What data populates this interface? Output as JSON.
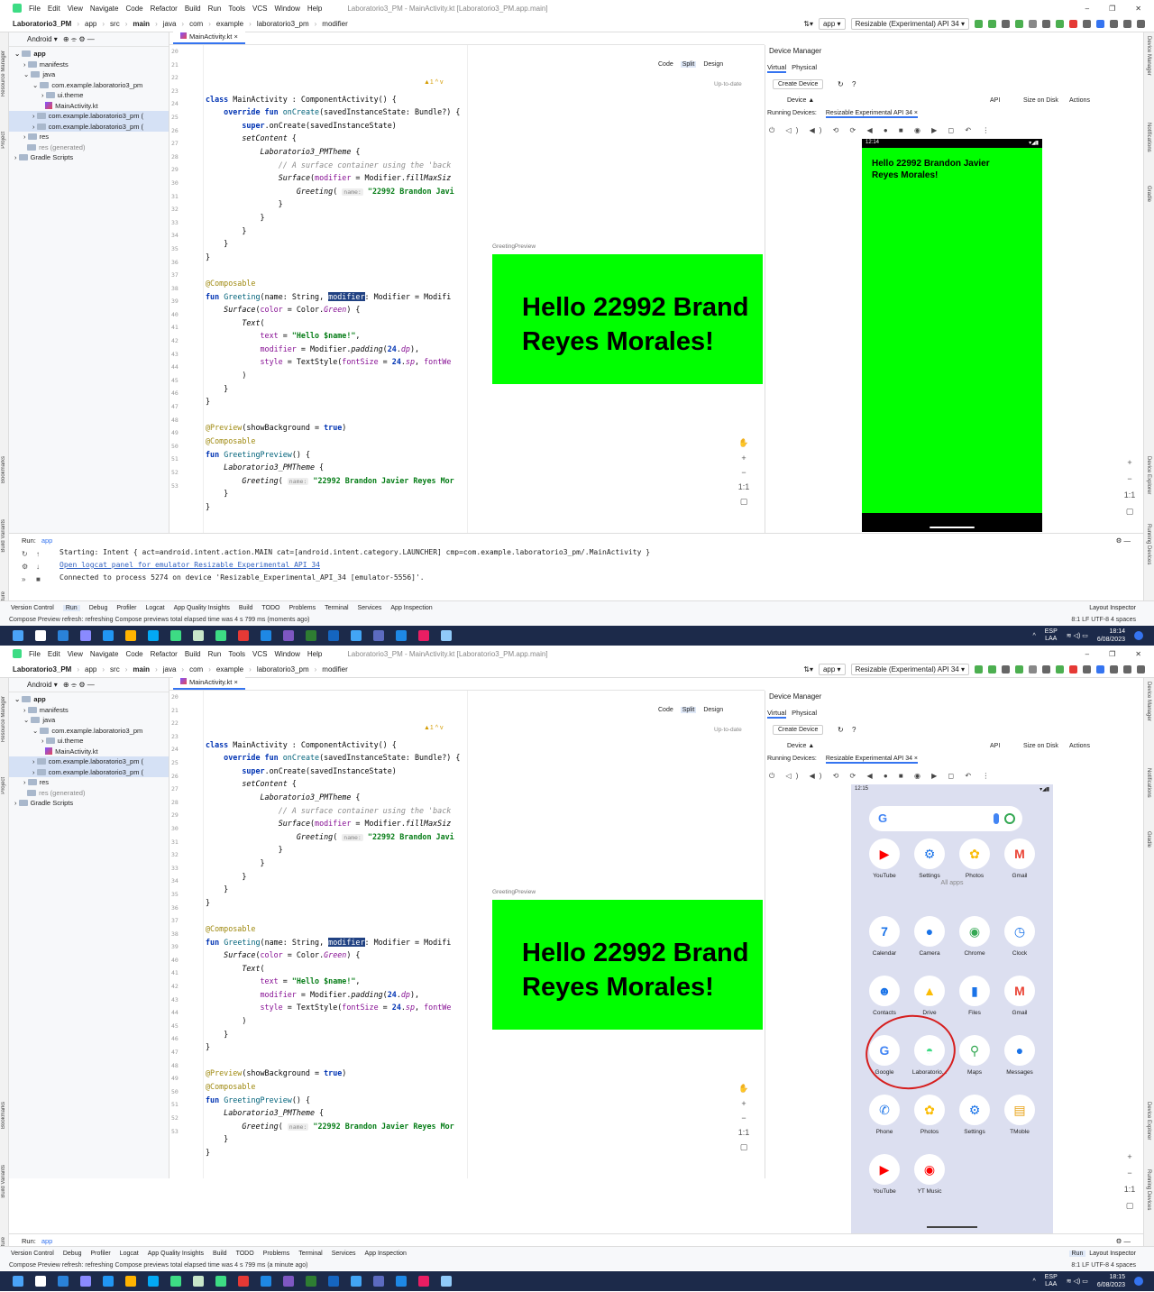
{
  "ide": {
    "menu": [
      "File",
      "Edit",
      "View",
      "Navigate",
      "Code",
      "Refactor",
      "Build",
      "Run",
      "Tools",
      "VCS",
      "Window",
      "Help"
    ],
    "window_title": "Laboratorio3_PM - MainActivity.kt [Laboratorio3_PM.app.main]",
    "breadcrumb": [
      "Laboratorio3_PM",
      "app",
      "src",
      "main",
      "java",
      "com",
      "example",
      "laboratorio3_pm",
      "modifier"
    ],
    "run_config": "app",
    "device_selector": "Resizable (Experimental) API 34",
    "project_view": "Android",
    "tree": [
      {
        "label": "app",
        "depth": 0
      },
      {
        "label": "manifests",
        "depth": 1
      },
      {
        "label": "java",
        "depth": 1
      },
      {
        "label": "com.example.laboratorio3_pm",
        "depth": 2
      },
      {
        "label": "ui.theme",
        "depth": 3
      },
      {
        "label": "MainActivity.kt",
        "depth": 3
      },
      {
        "label": "com.example.laboratorio3_pm (",
        "depth": 2
      },
      {
        "label": "com.example.laboratorio3_pm (",
        "depth": 2
      },
      {
        "label": "res",
        "depth": 1
      },
      {
        "label": "res (generated)",
        "depth": 1
      },
      {
        "label": "Gradle Scripts",
        "depth": 0
      }
    ],
    "editor_tab": "MainActivity.kt",
    "inspection": "▲1 ^ v",
    "view_modes": [
      "Code",
      "Split",
      "Design"
    ],
    "up_to_date": "Up-to-date",
    "preview_label": "GreetingPreview",
    "preview_text_line1": "Hello 22992 Brand",
    "preview_text_line2": "Reyes Morales!",
    "line_numbers": [
      "20",
      "21",
      "22",
      "23",
      "24",
      "25",
      "26",
      "27",
      "28",
      "29",
      "30",
      "31",
      "32",
      "33",
      "34",
      "35",
      "36",
      "37",
      "38",
      "39",
      "40",
      "41",
      "42",
      "43",
      "44",
      "45",
      "46",
      "47",
      "48",
      "49",
      "50",
      "51",
      "52",
      "53"
    ],
    "device_manager": {
      "title": "Device Manager",
      "tabs": [
        "Virtual",
        "Physical"
      ],
      "create": "Create Device",
      "help": "?",
      "col_device": "Device ▲",
      "col_api": "API",
      "col_size": "Size on Disk",
      "col_actions": "Actions",
      "running_label": "Running Devices:",
      "running_device": "Resizable Experimental API 34"
    },
    "run_panel": {
      "label": "Run:",
      "app": "app",
      "log1": "Starting: Intent { act=android.intent.action.MAIN cat=[android.intent.category.LAUNCHER] cmp=com.example.laboratorio3_pm/.MainActivity }",
      "log2": "Open logcat panel for emulator Resizable Experimental API 34",
      "log3": "Connected to process 5274 on device 'Resizable_Experimental_API_34 [emulator-5556]'."
    },
    "tool_windows": [
      "Version Control",
      "Run",
      "Debug",
      "Profiler",
      "Logcat",
      "App Quality Insights",
      "Build",
      "TODO",
      "Problems",
      "Terminal",
      "Services",
      "App Inspection"
    ],
    "tool_windows_2": [
      "Version Control",
      "Debug",
      "Profiler",
      "Logcat",
      "App Quality Insights",
      "Build",
      "TODO",
      "Problems",
      "Terminal",
      "Services",
      "App Inspection"
    ],
    "layout_inspector": "Layout Inspector",
    "status1": "Compose Preview refresh: refreshing Compose previews total elapsed time was 4 s 799 ms (moments ago)",
    "status2": "Compose Preview refresh: refreshing Compose previews total elapsed time was 4 s 799 ms (a minute ago)",
    "status_right": "8:1  LF  UTF-8  4 spaces",
    "left_strip": [
      "Resource Manager",
      "Project",
      "Bookmarks",
      "Build Variants",
      "Structure"
    ],
    "right_strip": [
      "Device Manager",
      "Notifications",
      "Gradle",
      "Device Explorer",
      "Running Devices"
    ]
  },
  "shot1": {
    "phone_time": "12:14",
    "app_message": "Hello 22992 Brandon Javier Reyes Morales!",
    "clock_time": "18:14",
    "clock_date": "6/08/2023"
  },
  "shot2": {
    "phone_time": "12:15",
    "all_apps": "All apps",
    "apps": [
      {
        "label": "YouTube",
        "color": "#ff0000",
        "glyph": "▶"
      },
      {
        "label": "Settings",
        "color": "#1a73e8",
        "glyph": "⚙"
      },
      {
        "label": "Photos",
        "color": "#fbbc04",
        "glyph": "✿"
      },
      {
        "label": "Gmail",
        "color": "#ea4335",
        "glyph": "M"
      },
      {
        "label": "Calendar",
        "color": "#1a73e8",
        "glyph": "7"
      },
      {
        "label": "Camera",
        "color": "#1a73e8",
        "glyph": "●"
      },
      {
        "label": "Chrome",
        "color": "#34a853",
        "glyph": "◉"
      },
      {
        "label": "Clock",
        "color": "#1a73e8",
        "glyph": "◷"
      },
      {
        "label": "Contacts",
        "color": "#1a73e8",
        "glyph": "☻"
      },
      {
        "label": "Drive",
        "color": "#fbbc04",
        "glyph": "▲"
      },
      {
        "label": "Files",
        "color": "#1a73e8",
        "glyph": "▮"
      },
      {
        "label": "Gmail",
        "color": "#ea4335",
        "glyph": "M"
      },
      {
        "label": "Google",
        "color": "#4285f4",
        "glyph": "G"
      },
      {
        "label": "Laboratorio...",
        "color": "#3ddc84",
        "glyph": "◓"
      },
      {
        "label": "Maps",
        "color": "#34a853",
        "glyph": "⚲"
      },
      {
        "label": "Messages",
        "color": "#1a73e8",
        "glyph": "●"
      },
      {
        "label": "Phone",
        "color": "#1a73e8",
        "glyph": "✆"
      },
      {
        "label": "Photos",
        "color": "#fbbc04",
        "glyph": "✿"
      },
      {
        "label": "Settings",
        "color": "#1a73e8",
        "glyph": "⚙"
      },
      {
        "label": "TMoble",
        "color": "#e8a317",
        "glyph": "▤"
      },
      {
        "label": "YouTube",
        "color": "#ff0000",
        "glyph": "▶"
      },
      {
        "label": "YT Music",
        "color": "#ff0000",
        "glyph": "◉"
      }
    ],
    "clock_time": "18:15",
    "clock_date": "6/08/2023"
  },
  "tray": {
    "lang1": "ESP",
    "lang2": "LAA"
  },
  "colors": {
    "accent": "#3574f0",
    "green": "#00ff00",
    "taskbar": "#1c2a4a",
    "annotation": "#d61f1f"
  }
}
